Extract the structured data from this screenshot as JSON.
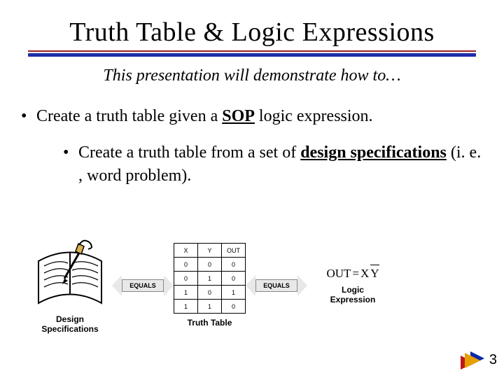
{
  "title": "Truth Table & Logic Expressions",
  "subtitle": "This presentation will demonstrate how to…",
  "bullets": {
    "b1_pre": "Create a truth table given a ",
    "b1_sop": "SOP",
    "b1_post": " logic expression.",
    "b2_pre": "Create a truth table from a set of ",
    "b2_ds": "design specifications",
    "b2_post": " (i. e. , word problem)."
  },
  "equals_label": "EQUALS",
  "truth_table": {
    "headers": [
      "X",
      "Y",
      "OUT"
    ],
    "rows": [
      [
        "0",
        "0",
        "0"
      ],
      [
        "0",
        "1",
        "0"
      ],
      [
        "1",
        "0",
        "1"
      ],
      [
        "1",
        "1",
        "0"
      ]
    ],
    "caption": "Truth Table"
  },
  "design_caption_l1": "Design",
  "design_caption_l2": "Specifications",
  "logic_expression": {
    "out": "OUT",
    "eq": "=",
    "x": "X",
    "y": "Y",
    "caption_l1": "Logic",
    "caption_l2": "Expression"
  },
  "page_number": "3"
}
